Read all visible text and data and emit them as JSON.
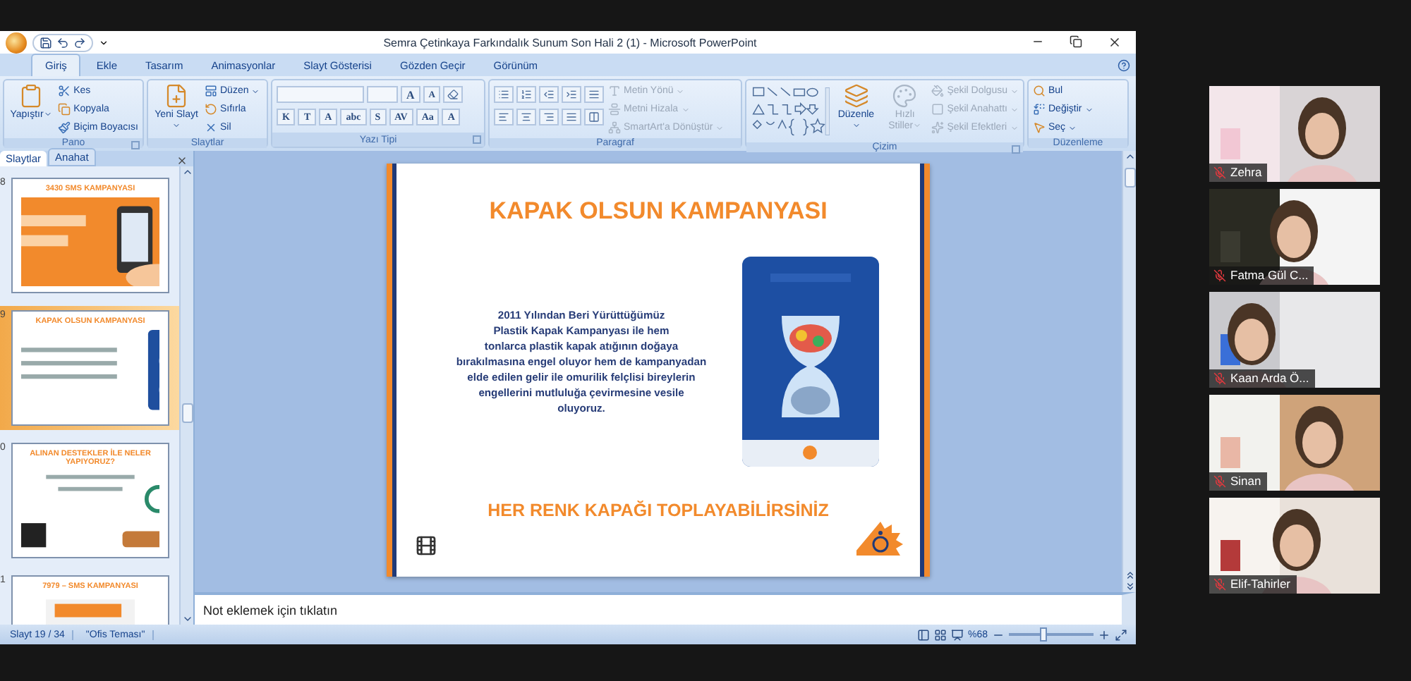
{
  "window": {
    "title": "Semra Çetinkaya Farkındalık Sunum Son Hali 2 (1) - Microsoft PowerPoint"
  },
  "ribbon_tabs": [
    {
      "label": "Giriş",
      "selected": true
    },
    {
      "label": "Ekle",
      "selected": false
    },
    {
      "label": "Tasarım",
      "selected": false
    },
    {
      "label": "Animasyonlar",
      "selected": false
    },
    {
      "label": "Slayt Gösterisi",
      "selected": false
    },
    {
      "label": "Gözden Geçir",
      "selected": false
    },
    {
      "label": "Görünüm",
      "selected": false
    }
  ],
  "ribbon_groups": [
    {
      "kind": "clipboard",
      "label": "Pano",
      "launcher": true,
      "items": [
        {
          "kind": "big",
          "label": "Yapıştır",
          "dropdown": true,
          "disabled": false
        },
        {
          "kind": "small",
          "label": "Kes",
          "dropdown": false,
          "disabled": false
        },
        {
          "kind": "small",
          "label": "Kopyala",
          "dropdown": false,
          "disabled": false
        },
        {
          "kind": "small",
          "label": "Biçim Boyacısı",
          "dropdown": false,
          "disabled": false
        }
      ]
    },
    {
      "kind": "slides",
      "label": "Slaytlar",
      "launcher": false,
      "items": [
        {
          "kind": "big",
          "label": "Yeni Slayt",
          "dropdown": true,
          "disabled": false
        },
        {
          "kind": "small",
          "label": "Düzen",
          "dropdown": true,
          "disabled": false
        },
        {
          "kind": "small",
          "label": "Sıfırla",
          "dropdown": false,
          "disabled": false
        },
        {
          "kind": "small",
          "label": "Sil",
          "dropdown": false,
          "disabled": false
        }
      ]
    },
    {
      "kind": "font",
      "label": "Yazı Tipi",
      "launcher": true,
      "top_buttons": [
        {
          "label": "A"
        },
        {
          "label": "A"
        }
      ],
      "buttons": [
        {
          "label": "K"
        },
        {
          "label": "T"
        },
        {
          "label": "A"
        },
        {
          "label": "abc"
        },
        {
          "label": "S"
        },
        {
          "label": "AV"
        },
        {
          "label": "Aa"
        },
        {
          "label": "A"
        }
      ]
    },
    {
      "kind": "paragraph",
      "label": "Paragraf",
      "launcher": false,
      "items": [
        {
          "kind": "small",
          "label": "Metin Yönü",
          "dropdown": true,
          "disabled": true
        },
        {
          "kind": "small",
          "label": "Metni Hizala",
          "dropdown": true,
          "disabled": true
        },
        {
          "kind": "small",
          "label": "SmartArt'a Dönüştür",
          "dropdown": true,
          "disabled": true
        }
      ]
    },
    {
      "kind": "drawing",
      "label": "Çizim",
      "launcher": true,
      "items": [
        {
          "kind": "big",
          "label": "Düzenle",
          "dropdown": true,
          "disabled": false
        },
        {
          "kind": "big",
          "label": "Hızlı Stiller",
          "dropdown": true,
          "disabled": true
        },
        {
          "kind": "small",
          "label": "Şekil Dolgusu",
          "dropdown": true,
          "disabled": true
        },
        {
          "kind": "small",
          "label": "Şekil Anahattı",
          "dropdown": true,
          "disabled": true
        },
        {
          "kind": "small",
          "label": "Şekil Efektleri",
          "dropdown": true,
          "disabled": true
        }
      ]
    },
    {
      "kind": "editing",
      "label": "Düzenleme",
      "launcher": false,
      "items": [
        {
          "kind": "small",
          "label": "Bul",
          "dropdown": false,
          "disabled": false
        },
        {
          "kind": "small",
          "label": "Değiştir",
          "dropdown": true,
          "disabled": false
        },
        {
          "kind": "small",
          "label": "Seç",
          "dropdown": true,
          "disabled": false
        }
      ]
    }
  ],
  "slide_panel": {
    "tabs": [
      {
        "label": "Slaytlar",
        "selected": true
      },
      {
        "label": "Anahat",
        "selected": false
      }
    ],
    "thumbnails": [
      {
        "number": "8",
        "title": "3430 SMS KAMPANYASI",
        "selected": false
      },
      {
        "number": "9",
        "title": "KAPAK OLSUN KAMPANYASI",
        "selected": true
      },
      {
        "number": "0",
        "title": "ALINAN DESTEKLER İLE NELER YAPIYORUZ?",
        "selected": false
      },
      {
        "number": "1",
        "title": "7979 – SMS KAMPANYASI",
        "selected": false
      }
    ]
  },
  "slide": {
    "title": "KAPAK OLSUN KAMPANYASI",
    "body_lines": [
      "2011 Yılından Beri Yürüttüğümüz",
      "Plastik Kapak Kampanyası ile hem",
      "tonlarca plastik kapak  atığının doğaya",
      "bırakılmasına engel oluyor hem de kampanyadan",
      "elde edilen gelir ile omurilik felçlisi bireylerin",
      "engellerini mutluluğa çevirmesine vesile",
      "oluyoruz."
    ],
    "footer": "HER RENK KAPAĞI TOPLAYABİLİRSİNİZ"
  },
  "notes": {
    "placeholder": "Not eklemek için tıklatın"
  },
  "status_bar": {
    "slide_info": "Slayt 19 / 34",
    "theme": "\"Ofis Teması\"",
    "zoom": "%68",
    "zoom_slider": {
      "level": 0.4
    }
  },
  "participants": [
    {
      "name": "Zehra",
      "muted": true
    },
    {
      "name": "Fatma Gül C...",
      "muted": true
    },
    {
      "name": "Kaan Arda Ö...",
      "muted": true
    },
    {
      "name": "Sinan",
      "muted": true
    },
    {
      "name": "Elif-Tahirler",
      "muted": true
    }
  ]
}
